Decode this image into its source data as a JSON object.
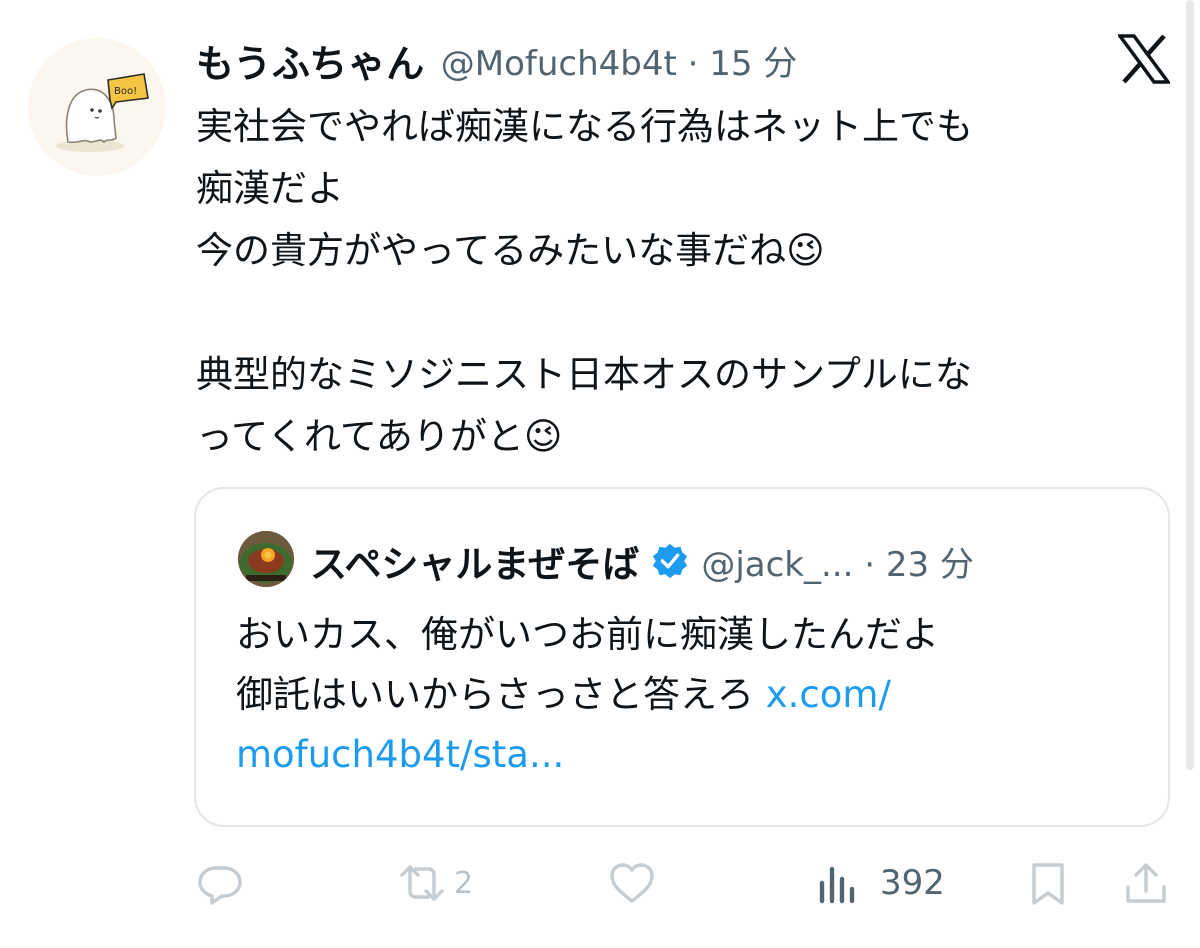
{
  "tweet": {
    "display_name": "もうふちゃん",
    "handle_time": "@Mofuch4b4t · 15 分",
    "text": "実社会でやれば痴漢になる行為はネット上でも\n痴漢だよ\n今の貴方がやってるみたいな事だね😉\n\n典型的なミソジニスト日本オスのサンプルにな\nってくれてありがと😉",
    "avatar_badge_text": "Boo!"
  },
  "quote": {
    "display_name": "スペシャルまぜそば",
    "handle_time": "@jack_... · 23 分",
    "text_plain": "おいカス、俺がいつお前に痴漢したんだよ\n御託はいいからさっさと答えろ ",
    "link_text": "x.com/\nmofuch4b4t/sta...",
    "verified_color": "#1d9bf0"
  },
  "actions": {
    "reply_icon": "reply-icon",
    "retweet_count": "2",
    "like_icon": "heart-icon",
    "views_count": "392",
    "bookmark_icon": "bookmark-icon",
    "share_icon": "share-icon"
  },
  "colors": {
    "text": "#0f1419",
    "secondary": "#536471",
    "link": "#1d9bf0",
    "muted_icon": "#c5ccd2"
  }
}
